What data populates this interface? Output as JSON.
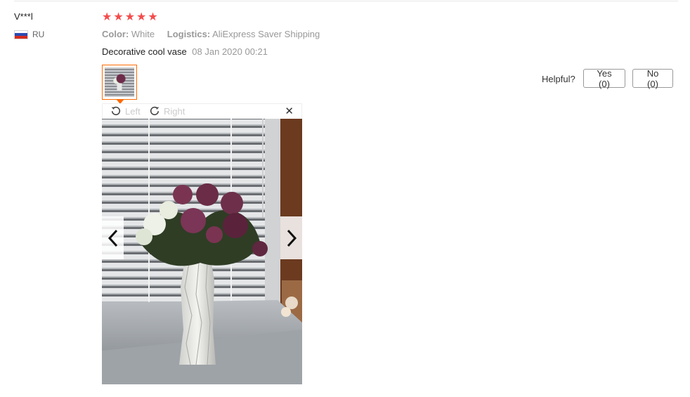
{
  "review": {
    "user": "V***l",
    "country_code": "RU",
    "flag_icon": "russia-flag-icon",
    "rating": 5,
    "stars": [
      "★",
      "★",
      "★",
      "★",
      "★"
    ],
    "star_color": "#f44c4c",
    "attributes": {
      "color_label": "Color:",
      "color_value": "White",
      "logistics_label": "Logistics:",
      "logistics_value": "AliExpress Saver Shipping"
    },
    "text": "Decorative cool vase",
    "date": "08 Jan 2020 00:21"
  },
  "helpful": {
    "label": "Helpful?",
    "yes": "Yes (0)",
    "no": "No (0)"
  },
  "viewer": {
    "rotate_left_label": "Left",
    "rotate_right_label": "Right",
    "close_glyph": "✕",
    "accent_color": "#ff6a00"
  }
}
